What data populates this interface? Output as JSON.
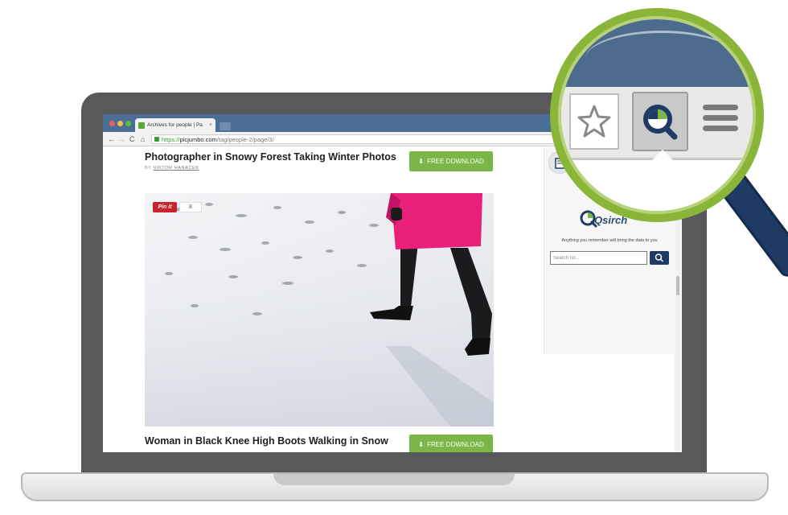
{
  "browser": {
    "tab_title": "Archives for people | Pa",
    "tab_close": "×",
    "url_scheme": "https://",
    "url_host": "picjumbo.com",
    "url_path": "/tag/people-2/page/3/",
    "nav": {
      "back": "←",
      "forward": "→",
      "reload": "C",
      "home": "⌂"
    }
  },
  "posts": [
    {
      "title": "Photographer in Snowy Forest Taking Winter Photos",
      "byline_prefix": "BY",
      "author": "VIKTOR HANACEK",
      "download_label": "FREE DOWNLOAD"
    },
    {
      "title": "Woman in Black Knee High Boots Walking in Snow",
      "download_label": "FREE DOWNLOAD"
    }
  ],
  "pinterest": {
    "label": "Pin it",
    "count": "8"
  },
  "qsirch": {
    "logo_text": "Qsirch",
    "tagline": "Anything you remember will bring the data to you",
    "search_placeholder": "Search for..."
  },
  "icons": {
    "download": "download-icon",
    "search": "search-icon",
    "star": "star-icon",
    "menu": "hamburger-menu-icon",
    "qsirch": "qsirch-logo-icon"
  },
  "colors": {
    "accent_green": "#7ab648",
    "qsirch_navy": "#1f3b63",
    "ring_green": "#8ab539",
    "pinterest_red": "#c8232c",
    "coat_pink": "#e8207a"
  }
}
